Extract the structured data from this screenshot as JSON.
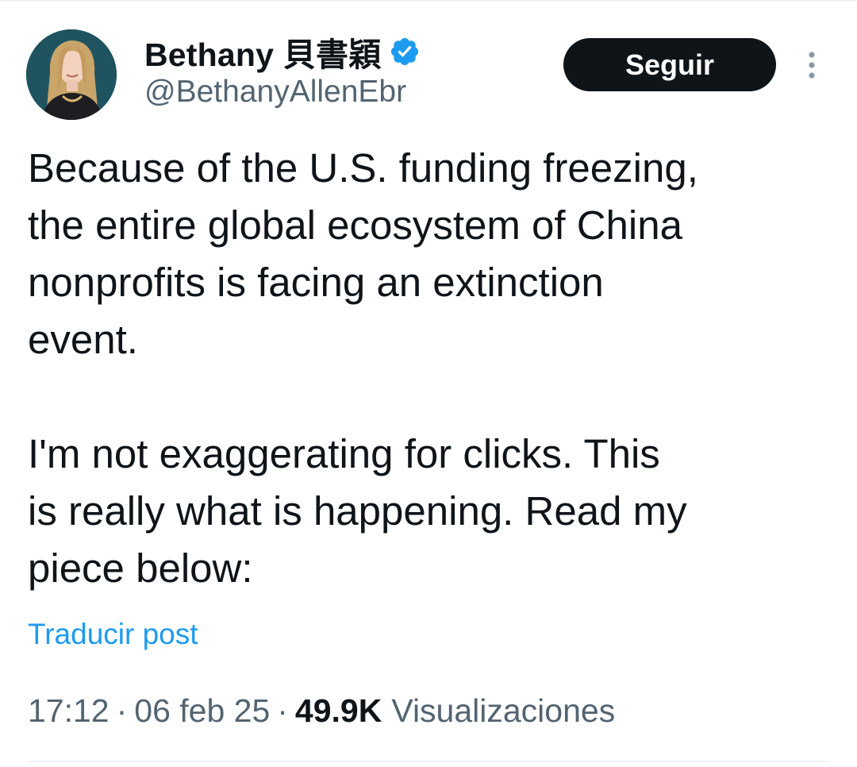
{
  "author": {
    "display_name": "Bethany 貝書穎",
    "handle": "@BethanyAllenEbr",
    "verified": true,
    "avatar_icon": "profile-photo"
  },
  "actions": {
    "follow_label": "Seguir",
    "more_icon": "vertical-ellipsis-icon"
  },
  "tweet": {
    "lines_para1": [
      "Because of the U.S. funding freezing,",
      "the entire global ecosystem of China",
      "nonprofits is facing an extinction",
      "event."
    ],
    "lines_para2": [
      "I'm not exaggerating for clicks. This",
      "is really what is happening. Read my",
      "piece below:"
    ]
  },
  "translate_label": "Traducir post",
  "meta": {
    "time": "17:12",
    "date": "06 feb 25",
    "separator": "·",
    "views_count": "49.9K",
    "views_label": "Visualizaciones"
  },
  "colors": {
    "text_primary": "#0f1419",
    "text_secondary": "#536471",
    "link_blue": "#1d9bf0",
    "verified_blue": "#1d9bf0",
    "button_bg": "#0f1419"
  }
}
